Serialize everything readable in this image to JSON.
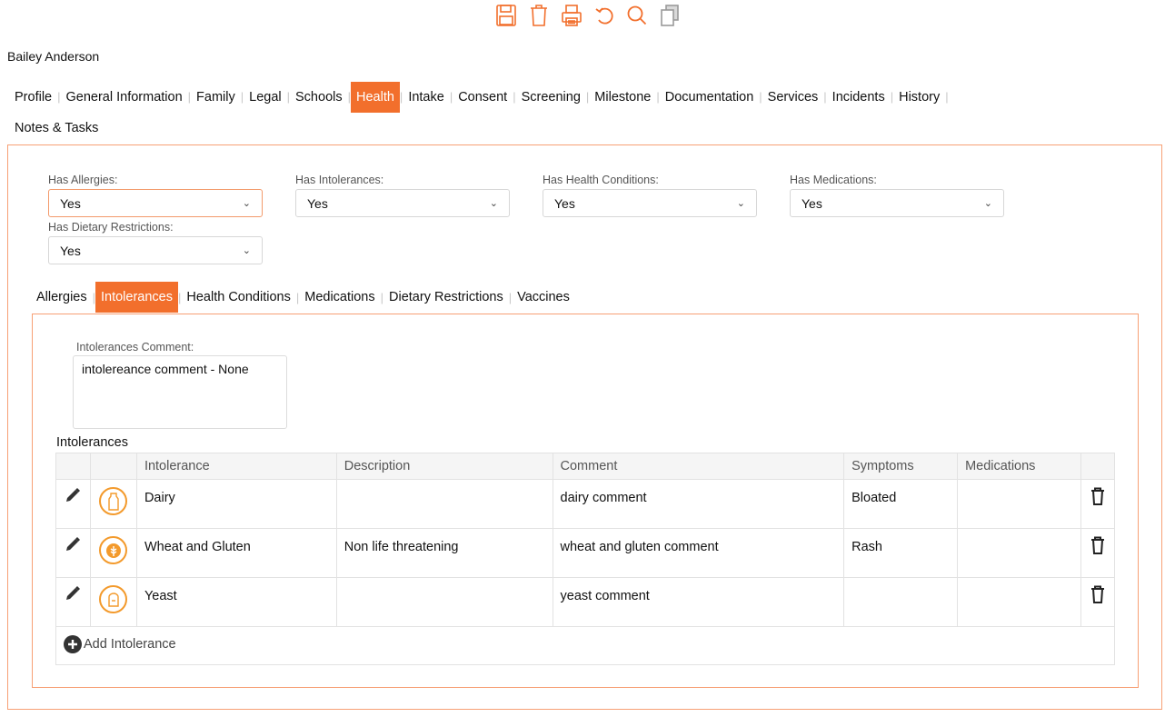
{
  "toolbar": {
    "icons": [
      "save-icon",
      "trash-icon",
      "print-icon",
      "undo-icon",
      "search-icon",
      "copy-icon"
    ],
    "color": "#f26f2c"
  },
  "person": {
    "name": "Bailey Anderson"
  },
  "main_nav": {
    "row1": [
      "Profile",
      "General Information",
      "Family",
      "Legal",
      "Schools",
      "Health",
      "Intake",
      "Consent",
      "Screening",
      "Milestone",
      "Documentation",
      "Services",
      "Incidents",
      "History"
    ],
    "row2": [
      "Notes & Tasks"
    ],
    "active": "Health"
  },
  "fields": {
    "has_allergies": {
      "label": "Has Allergies:",
      "value": "Yes"
    },
    "has_intolerances": {
      "label": "Has Intolerances:",
      "value": "Yes"
    },
    "has_health_conditions": {
      "label": "Has Health Conditions:",
      "value": "Yes"
    },
    "has_medications": {
      "label": "Has Medications:",
      "value": "Yes"
    },
    "has_dietary_restrictions": {
      "label": "Has Dietary Restrictions:",
      "value": "Yes"
    }
  },
  "sub_tabs": {
    "items": [
      "Allergies",
      "Intolerances",
      "Health Conditions",
      "Medications",
      "Dietary Restrictions",
      "Vaccines"
    ],
    "active": "Intolerances"
  },
  "intolerances_comment": {
    "label": "Intolerances Comment:",
    "value": "intolereance comment - None"
  },
  "table": {
    "title": "Intolerances",
    "columns": [
      "Intolerance",
      "Description",
      "Comment",
      "Symptoms",
      "Medications"
    ],
    "rows": [
      {
        "icon": "milk-bottle-icon",
        "intolerance": "Dairy",
        "description": "",
        "comment": "dairy comment",
        "symptoms": "Bloated",
        "medications": ""
      },
      {
        "icon": "wheat-icon",
        "intolerance": "Wheat and Gluten",
        "description": "Non life threatening",
        "comment": "wheat and gluten comment",
        "symptoms": "Rash",
        "medications": ""
      },
      {
        "icon": "bread-icon",
        "intolerance": "Yeast",
        "description": "",
        "comment": "yeast comment",
        "symptoms": "",
        "medications": ""
      }
    ],
    "add_label": "Add Intolerance"
  },
  "colors": {
    "accent": "#f26f2c",
    "border": "#f7a075",
    "icon_ring": "#f39a2c"
  }
}
